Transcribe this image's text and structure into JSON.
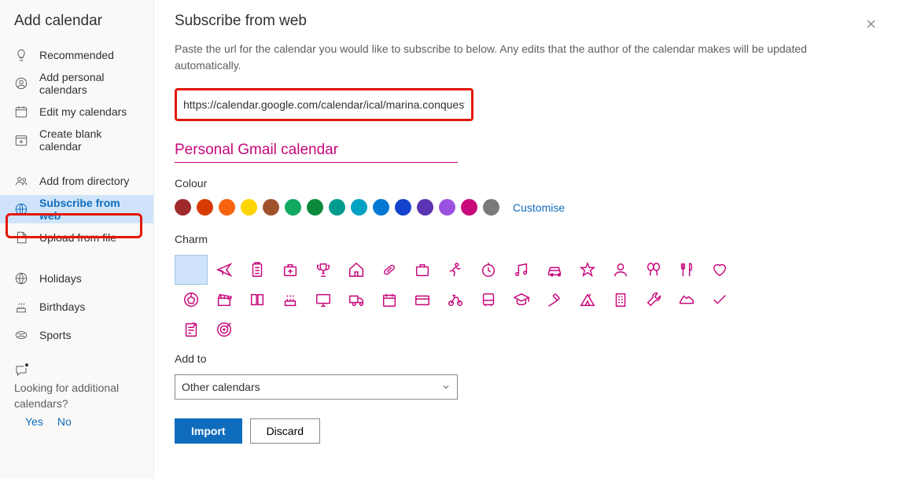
{
  "sidebar": {
    "title": "Add calendar",
    "items": [
      {
        "label": "Recommended"
      },
      {
        "label": "Add personal calendars"
      },
      {
        "label": "Edit my calendars"
      },
      {
        "label": "Create blank calendar"
      },
      {
        "label": "Add from directory"
      },
      {
        "label": "Subscribe from web"
      },
      {
        "label": "Upload from file"
      },
      {
        "label": "Holidays"
      },
      {
        "label": "Birthdays"
      },
      {
        "label": "Sports"
      }
    ],
    "looking_text": "Looking for additional calendars?",
    "yes": "Yes",
    "no": "No"
  },
  "main": {
    "title": "Subscribe from web",
    "desc": "Paste the url for the calendar you would like to subscribe to below. Any edits that the author of the calendar makes will be updated automatically.",
    "url_value": "https://calendar.google.com/calendar/ical/marina.conquest...",
    "calendar_name": "Personal Gmail calendar",
    "colour_label": "Colour",
    "customise": "Customise",
    "charm_label": "Charm",
    "addto_label": "Add to",
    "addto_selected": "Other calendars",
    "import": "Import",
    "discard": "Discard",
    "colours": [
      "#a6252b",
      "#d83b01",
      "#f7630c",
      "#ffb900",
      "#845b3d",
      "#10893e",
      "#008272",
      "#00b294",
      "#038387",
      "#0078d4",
      "#004e8c",
      "#4f6bed",
      "#8764b8",
      "#c239b3",
      "#e3008c",
      "#767676"
    ],
    "colours_alt": [
      "#a4262c",
      "#ca5010",
      "#e8701a"
    ]
  }
}
